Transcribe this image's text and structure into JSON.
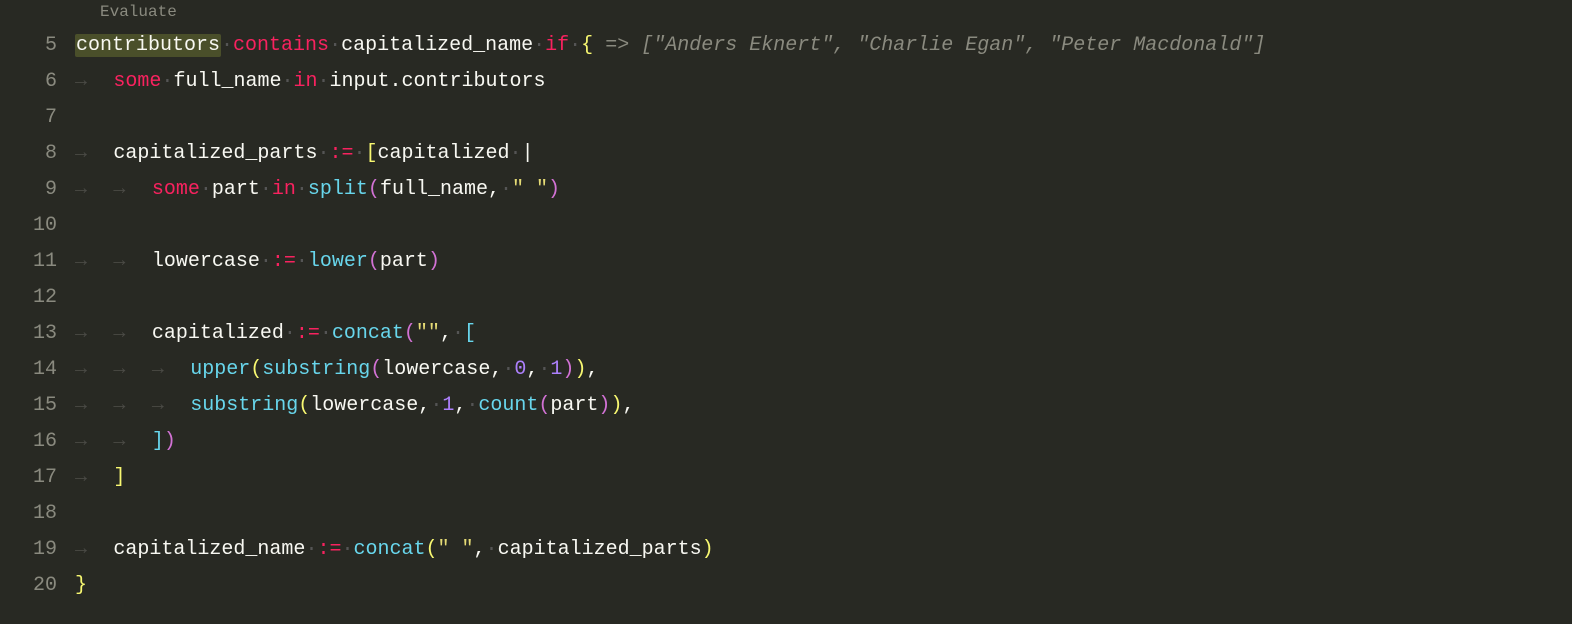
{
  "codelens": "Evaluate",
  "gutter_start": 5,
  "gutter_end": 20,
  "tokens": {
    "contributors": "contributors",
    "contains": "contains",
    "capitalized_name": "capitalized_name",
    "if": "if",
    "arrow": "=>",
    "hint": "[\"Anders Eknert\", \"Charlie Egan\", \"Peter Macdonald\"]",
    "some": "some",
    "full_name": "full_name",
    "in": "in",
    "input_contributors": "input.contributors",
    "capitalized_parts": "capitalized_parts",
    "assign": ":=",
    "capitalized": "capitalized",
    "part": "part",
    "split": "split",
    "space_str": "\" \"",
    "lowercase": "lowercase",
    "lower": "lower",
    "concat": "concat",
    "empty_str": "\"\"",
    "upper": "upper",
    "substring": "substring",
    "zero": "0",
    "one": "1",
    "count": "count"
  }
}
